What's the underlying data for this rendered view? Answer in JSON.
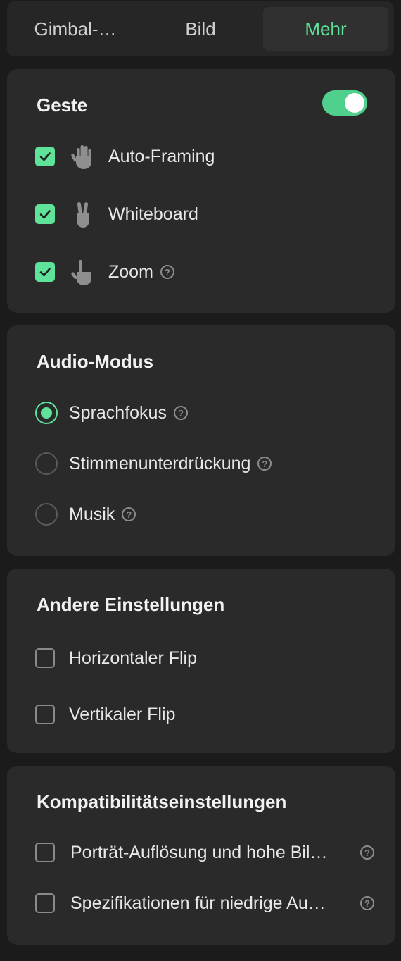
{
  "tabs": [
    {
      "label": "Gimbal-…",
      "active": false
    },
    {
      "label": "Bild",
      "active": false
    },
    {
      "label": "Mehr",
      "active": true
    }
  ],
  "gesture": {
    "title": "Geste",
    "enabled": true,
    "items": [
      {
        "label": "Auto-Framing",
        "checked": true,
        "icon": "open-hand-icon"
      },
      {
        "label": "Whiteboard",
        "checked": true,
        "icon": "victory-hand-icon"
      },
      {
        "label": "Zoom",
        "checked": true,
        "icon": "pointing-hand-icon",
        "help": "?"
      }
    ]
  },
  "audio": {
    "title": "Audio-Modus",
    "options": [
      {
        "label": "Sprachfokus",
        "selected": true,
        "help": "?"
      },
      {
        "label": "Stimmenunterdrückung",
        "selected": false,
        "help": "?"
      },
      {
        "label": "Musik",
        "selected": false,
        "help": "?"
      }
    ]
  },
  "other": {
    "title": "Andere Einstellungen",
    "items": [
      {
        "label": "Horizontaler Flip",
        "checked": false
      },
      {
        "label": "Vertikaler Flip",
        "checked": false
      }
    ]
  },
  "compat": {
    "title": "Kompatibilitätseinstellungen",
    "items": [
      {
        "label": "Porträt-Auflösung und hohe Bil…",
        "checked": false,
        "help": "?"
      },
      {
        "label": "Spezifikationen für niedrige Au…",
        "checked": false,
        "help": "?"
      }
    ]
  },
  "colors": {
    "accent": "#5fe29a",
    "card": "#2a2a2a",
    "background": "#1b1b1b"
  }
}
